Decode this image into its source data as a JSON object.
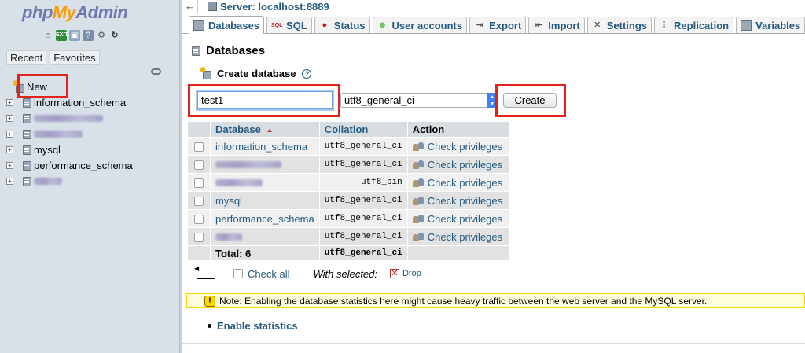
{
  "nav": {
    "logo": {
      "php": "php",
      "my": "My",
      "admin": "Admin"
    },
    "icons": [
      "home-icon",
      "exit-icon",
      "sql-query-icon",
      "docs-icon",
      "settings-icon",
      "reload-icon"
    ],
    "tabs": {
      "recent": "Recent",
      "favorites": "Favorites"
    },
    "new_label": "New",
    "databases": [
      {
        "label": "information_schema",
        "redacted": false
      },
      {
        "label": "",
        "redacted": true
      },
      {
        "label": "",
        "redacted": true
      },
      {
        "label": "mysql",
        "redacted": false
      },
      {
        "label": "performance_schema",
        "redacted": false
      },
      {
        "label": "",
        "redacted": true
      }
    ]
  },
  "header": {
    "back_label": "←",
    "server": "Server: localhost:8889"
  },
  "tabs": [
    {
      "label": "Databases",
      "icon": "database-icon",
      "active": true
    },
    {
      "label": "SQL",
      "icon": "sql-icon",
      "active": false
    },
    {
      "label": "Status",
      "icon": "status-icon",
      "active": false
    },
    {
      "label": "User accounts",
      "icon": "users-icon",
      "active": false
    },
    {
      "label": "Export",
      "icon": "export-icon",
      "active": false
    },
    {
      "label": "Import",
      "icon": "import-icon",
      "active": false
    },
    {
      "label": "Settings",
      "icon": "settings-icon",
      "active": false
    },
    {
      "label": "Replication",
      "icon": "replication-icon",
      "active": false
    },
    {
      "label": "Variables",
      "icon": "variables-icon",
      "active": false
    }
  ],
  "page": {
    "title": "Databases",
    "create_label": "Create database",
    "db_name_value": "test1",
    "collation_value": "utf8_general_ci",
    "create_button": "Create"
  },
  "table": {
    "headers": {
      "database": "Database",
      "collation": "Collation",
      "action": "Action"
    },
    "rows": [
      {
        "name": "information_schema",
        "redacted": false,
        "collation": "utf8_general_ci",
        "action": "Check privileges"
      },
      {
        "name": "",
        "redacted": true,
        "collation": "utf8_general_ci",
        "action": "Check privileges"
      },
      {
        "name": "",
        "redacted": true,
        "collation": "utf8_bin",
        "action": "Check privileges"
      },
      {
        "name": "mysql",
        "redacted": false,
        "collation": "utf8_general_ci",
        "action": "Check privileges"
      },
      {
        "name": "performance_schema",
        "redacted": false,
        "collation": "utf8_general_ci",
        "action": "Check privileges"
      },
      {
        "name": "",
        "redacted": true,
        "collation": "utf8_general_ci",
        "action": "Check privileges"
      }
    ],
    "total_label": "Total: 6",
    "total_collation": "utf8_general_ci"
  },
  "bulk": {
    "check_all": "Check all",
    "with_selected": "With selected:",
    "drop": "Drop"
  },
  "notice": {
    "icon": "!",
    "text": "Note: Enabling the database statistics here might cause heavy traffic between the web server and the MySQL server."
  },
  "enable_stats": "Enable statistics",
  "colors": {
    "link": "#235a81",
    "highlight_box": "#e0241b",
    "nav_bg": "#d9e1e8",
    "notice_bg": "#ffffdd"
  }
}
